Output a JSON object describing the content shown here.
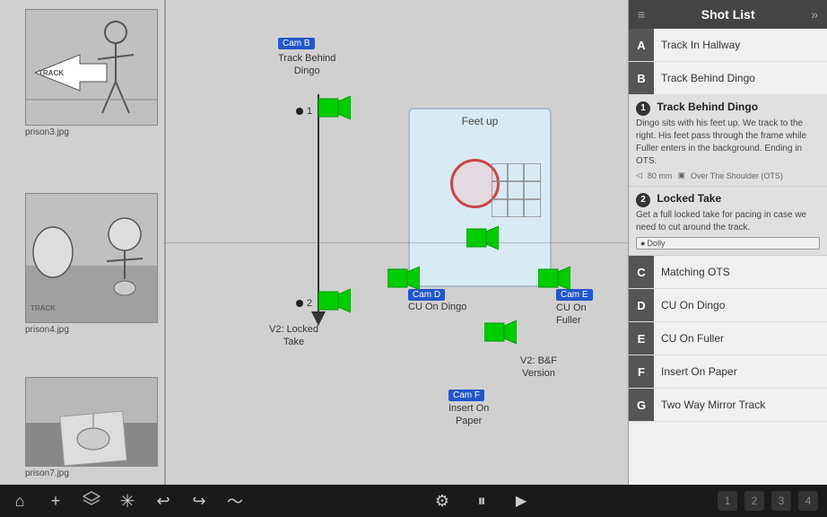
{
  "panel": {
    "title": "Shot List",
    "icon": "≡",
    "arrow": "»"
  },
  "shots": [
    {
      "letter": "A",
      "label": "Track In Hallway"
    },
    {
      "letter": "B",
      "label": "Track Behind Dingo"
    }
  ],
  "detail1": {
    "number": "1",
    "title": "Track Behind Dingo",
    "text": "Dingo sits with his feet up. We track to the right. His feet pass through the frame while Fuller enters in the background. Ending in OTS.",
    "lens": "80 mm",
    "shot_type": "Over The Shoulder (OTS)"
  },
  "detail2": {
    "number": "2",
    "title": "Locked Take",
    "text": "Get a full locked take for pacing in case we need to cut around the track.",
    "dolly": "Dolly"
  },
  "shots_bottom": [
    {
      "letter": "C",
      "label": "Matching OTS"
    },
    {
      "letter": "D",
      "label": "CU On Dingo"
    },
    {
      "letter": "E",
      "label": "CU On Fuller"
    },
    {
      "letter": "F",
      "label": "Insert On Paper"
    },
    {
      "letter": "G",
      "label": "Two Way Mirror Track"
    }
  ],
  "storyboards": [
    {
      "file": "prison3.jpg"
    },
    {
      "file": "prison4.jpg"
    },
    {
      "file": "prison7.jpg"
    }
  ],
  "cameras": {
    "cam_b": {
      "label": "Cam B",
      "sublabel": "Track Behind\nDingo"
    },
    "cam_d": {
      "label": "Cam D",
      "sublabel": "CU On Dingo"
    },
    "cam_e": {
      "label": "Cam E",
      "sublabel": "CU On\nFuller"
    },
    "cam_f": {
      "label": "Cam F",
      "sublabel": "Insert On\nPaper"
    }
  },
  "scene_labels": {
    "feet_up": "Feet up"
  },
  "diagram_labels": {
    "v2_locked": "V2: Locked\nTake",
    "v2_bf": "V2: B&F\nVersion",
    "point1": "1",
    "point2": "2"
  },
  "toolbar": {
    "home": "⌂",
    "add": "+",
    "layers": "◈",
    "asterisk": "✳",
    "back": "↩",
    "forward": "↪",
    "squiggle": "〜",
    "puzzle": "⚙",
    "pause": "⏸",
    "play": "▶",
    "num1": "1",
    "num2": "2",
    "num3": "3",
    "num4": "4"
  }
}
